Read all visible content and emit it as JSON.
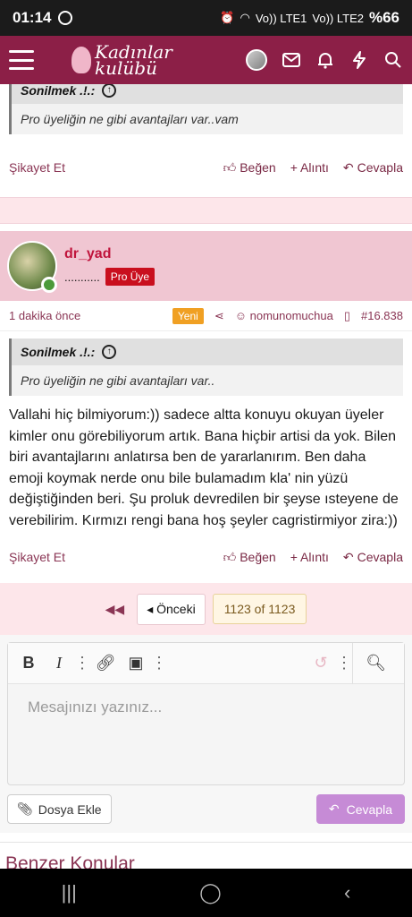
{
  "status": {
    "time": "01:14",
    "net1": "Vo)) LTE1",
    "net2": "Vo)) LTE2",
    "battery": "%66"
  },
  "header": {
    "logo_line1": "Kadınlar",
    "logo_line2": "kulübü"
  },
  "post1": {
    "quote_author": "Sonilmek .!.:",
    "quote_text": "Pro üyeliğin ne gibi avantajları var..vam",
    "report": "Şikayet Et",
    "like": "Beğen",
    "quote": "+ Alıntı",
    "reply": "Cevapla"
  },
  "post2": {
    "username": "dr_yad",
    "dots": "...........",
    "badge": "Pro Üye",
    "time": "1 dakika önce",
    "new_badge": "Yeni",
    "mention": "nomunomuchua",
    "post_number": "#16.838",
    "quote_author": "Sonilmek .!.:",
    "quote_text": "Pro üyeliğin ne gibi avantajları var..",
    "message": "Vallahi hiç bilmiyorum:)) sadece altta konuyu okuyan üyeler kimler onu görebiliyorum artık. Bana hiçbir artisi da yok. Bilen biri avantajlarını anlatırsa ben de yararlanırım. Ben daha emoji koymak nerde onu bile bulamadım kla' nin yüzü değiştiğinden beri. Şu proluk devredilen bir şeyse ısteyene de verebilirim. Kırmızı rengi bana hoş şeyler cagristirmiyor zira:))",
    "report": "Şikayet Et",
    "like": "Beğen",
    "quote": "+ Alıntı",
    "reply": "Cevapla"
  },
  "pagination": {
    "prev": "Önceki",
    "current": "1123 of 1123"
  },
  "editor": {
    "placeholder": "Mesajınızı yazınız...",
    "attach": "Dosya Ekle",
    "submit": "Cevapla"
  },
  "similar": {
    "title": "Benzer Konular"
  }
}
